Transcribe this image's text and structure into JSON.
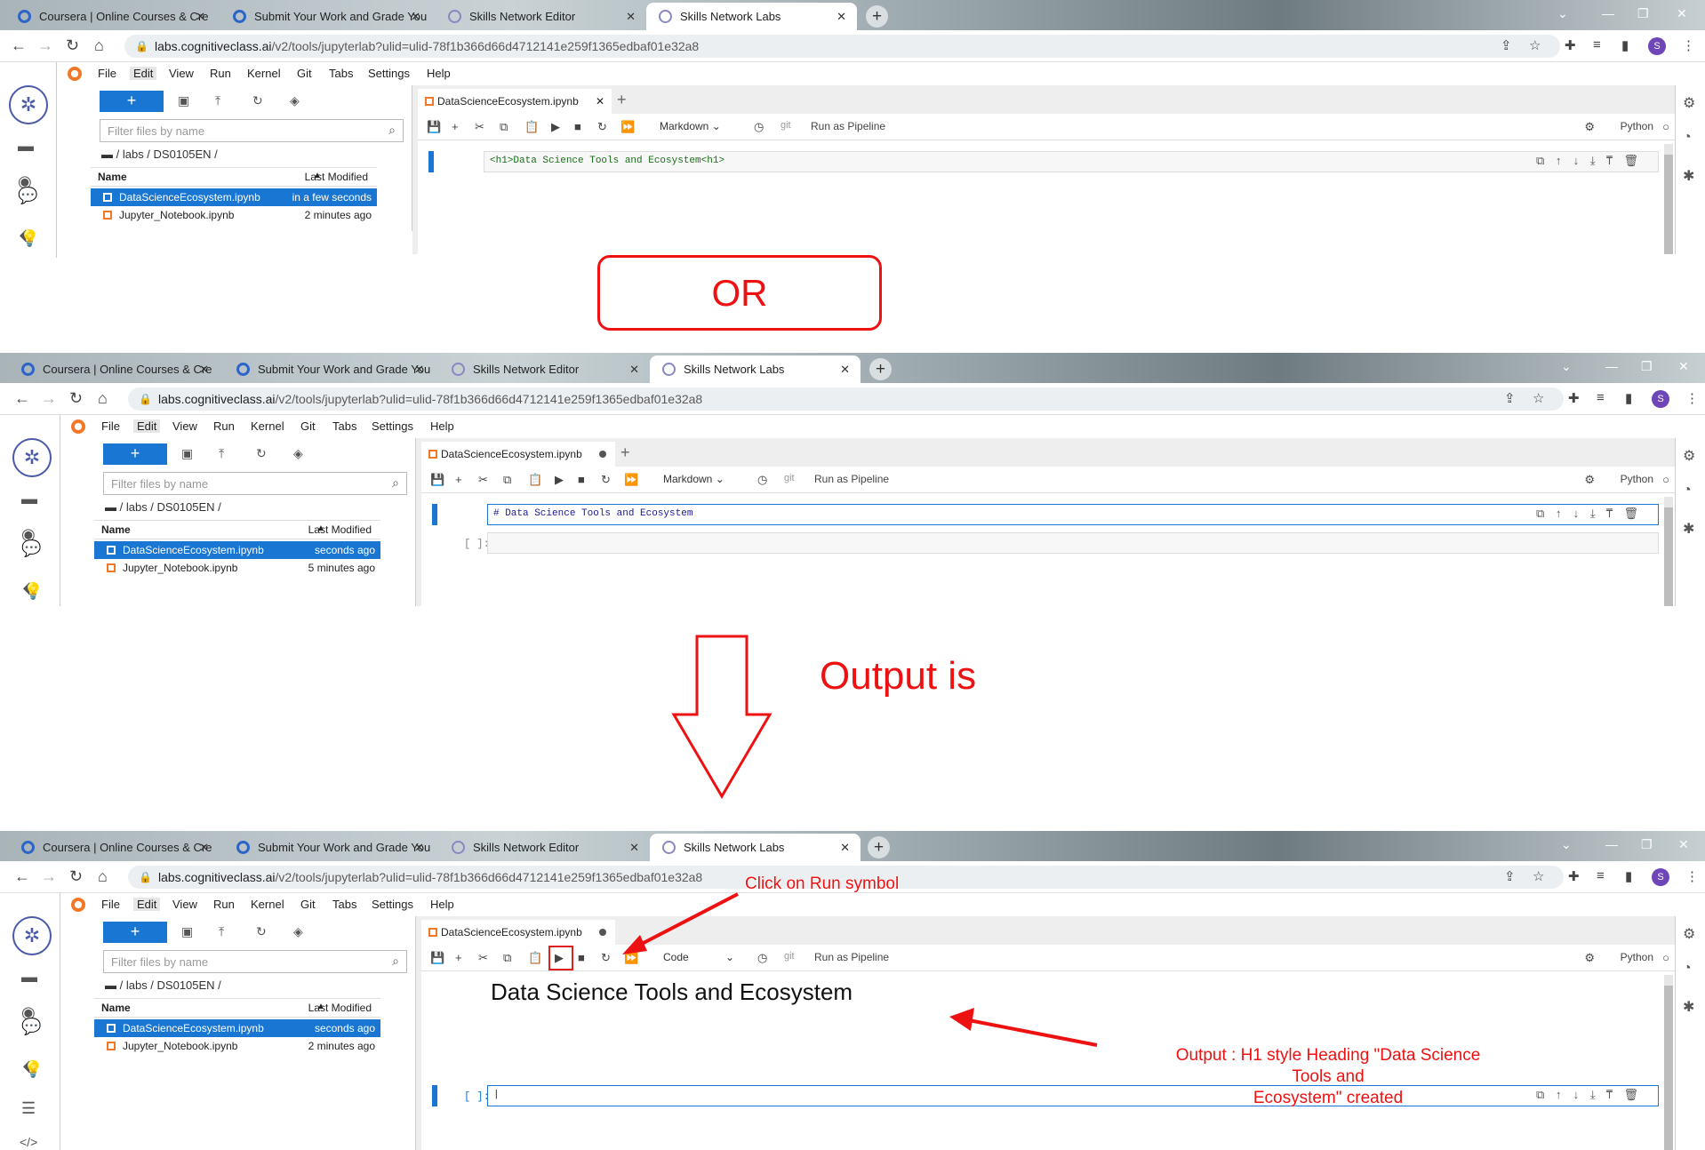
{
  "browser": {
    "tabs": [
      "Coursera | Online Courses & Cre",
      "Submit Your Work and Grade You",
      "Skills Network Editor",
      "Skills Network Labs"
    ],
    "url_host": "labs.cognitiveclass.ai",
    "url_path": "/v2/tools/jupyterlab?ulid=ulid-78f1b366d66d4712141e259f1365edbaf01e32a8",
    "profile": "S"
  },
  "jupyter": {
    "menu": [
      "File",
      "Edit",
      "View",
      "Run",
      "Kernel",
      "Git",
      "Tabs",
      "Settings",
      "Help"
    ],
    "filter_placeholder": "Filter files by name",
    "breadcrumb": "/ labs / DS0105EN /",
    "col_name": "Name",
    "col_modified": "Last Modified",
    "notebook_tab": "DataScienceEcosystem.ipynb",
    "run_as_pipeline": "Run as Pipeline",
    "git": "git",
    "kernel": "Python",
    "prompt_empty": "[ ]:"
  },
  "screens": [
    {
      "files": [
        {
          "name": "DataScienceEcosystem.ipynb",
          "modified": "in a few seconds"
        },
        {
          "name": "Jupyter_Notebook.ipynb",
          "modified": "2 minutes ago"
        }
      ],
      "cell_type": "Markdown",
      "cell_source": "<h1>Data Science Tools and Ecosystem<h1>"
    },
    {
      "files": [
        {
          "name": "DataScienceEcosystem.ipynb",
          "modified": "seconds ago"
        },
        {
          "name": "Jupyter_Notebook.ipynb",
          "modified": "5 minutes ago"
        }
      ],
      "cell_type": "Markdown",
      "cell_source": "# Data Science Tools and Ecosystem"
    },
    {
      "files": [
        {
          "name": "DataScienceEcosystem.ipynb",
          "modified": "seconds ago"
        },
        {
          "name": "Jupyter_Notebook.ipynb",
          "modified": "2 minutes ago"
        }
      ],
      "cell_type": "Code",
      "rendered_heading": "Data Science Tools and Ecosystem"
    }
  ],
  "annotations": {
    "or": "OR",
    "output_is": "Output is",
    "click_run": "Click on Run symbol",
    "output_line1": "Output : H1 style Heading \"Data Science Tools and",
    "output_line2": "Ecosystem\" created"
  },
  "colors": {
    "accent": "#1976d2",
    "annotation": "#e11111",
    "notebook_icon": "#f37726"
  }
}
